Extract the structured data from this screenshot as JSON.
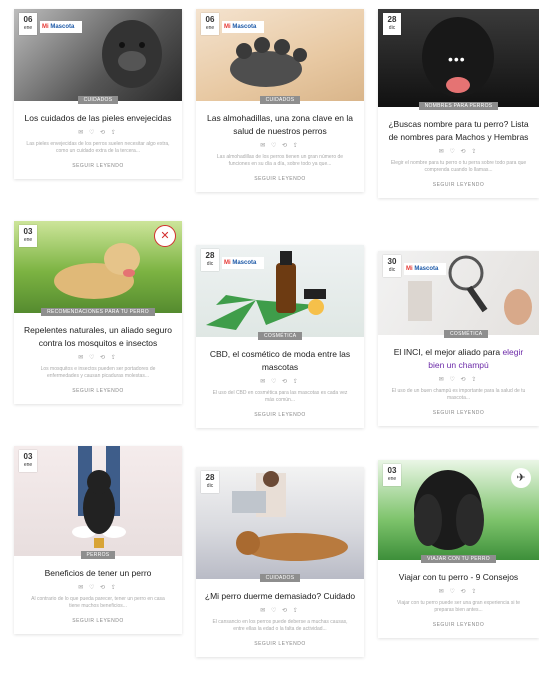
{
  "brand": {
    "part1": "Mi ",
    "part2": "Mascota"
  },
  "cards": [
    {
      "day": "06",
      "month": "ene",
      "category": "Cuidados",
      "title": "Los cuidados de las pieles envejecidas",
      "meta": "✉ ♡ ⟲ ⇪",
      "excerpt": "Las pieles envejecidas de los perros suelen necesitar algo extra, como un cuidado extra de la tercera...",
      "more": "Seguir leyendo"
    },
    {
      "day": "06",
      "month": "ene",
      "category": "Cuidados",
      "title": "Las almohadillas, una zona clave en la salud de nuestros perros",
      "meta": "✉ ♡ ⟲ ⇪",
      "excerpt": "Las almohadillas de los perros tienen un gran número de funciones en su día a día, sobre todo ya que...",
      "more": "Seguir leyendo"
    },
    {
      "day": "28",
      "month": "dic",
      "category": "Nombres para perros",
      "title": "¿Buscas nombre para tu perro? Lista de nombres para Machos y Hembras",
      "meta": "✉ ♡ ⟲ ⇪",
      "excerpt": "Elegir el nombre para tu perro o tu perra sobre todo para que comprenda cuando lo llamas...",
      "more": "Seguir leyendo"
    },
    {
      "day": "03",
      "month": "ene",
      "category": "Recomendaciones para tu perro",
      "title": "Repelentes naturales, un aliado seguro contra los mosquitos e insectos",
      "meta": "✉ ♡ ⟲ ⇪",
      "excerpt": "Los mosquitos e insectos pueden ser portadores de enfermedades y causan picaduras molestas...",
      "more": "Seguir leyendo"
    },
    {
      "day": "28",
      "month": "dic",
      "category": "Cosmética",
      "title": "CBD, el cosmético de moda entre las mascotas",
      "meta": "✉ ♡ ⟲ ⇪",
      "excerpt": "El uso del CBD en cosmética para las mascotas es cada vez más común...",
      "more": "Seguir leyendo"
    },
    {
      "day": "30",
      "month": "dic",
      "category": "Cosmética",
      "title_a": "El INCI, el mejor aliado para ",
      "title_b": "elegir bien un champú",
      "meta": "✉ ♡ ⟲ ⇪",
      "excerpt": "El uso de un buen champú es importante para la salud de tu mascota...",
      "more": "Seguir leyendo"
    },
    {
      "day": "03",
      "month": "ene",
      "category": "Perros",
      "title": "Beneficios de tener un perro",
      "meta": "✉ ♡ ⟲ ⇪",
      "excerpt": "Al contrario de lo que pueda parecer, tener un perro en casa tiene muchos beneficios...",
      "more": "Seguir leyendo"
    },
    {
      "day": "28",
      "month": "dic",
      "category": "Cuidados",
      "title": "¿Mi perro duerme demasiado? Cuidado",
      "meta": "✉ ♡ ⟲ ⇪",
      "excerpt": "El cansancio en los perros puede deberse a muchas causas, entre ellas la edad o la falta de actividad...",
      "more": "Seguir leyendo"
    },
    {
      "day": "03",
      "month": "ene",
      "category": "Viajar con tu perro",
      "title": "Viajar con tu perro - 9 Consejos",
      "meta": "✉ ♡ ⟲ ⇪",
      "excerpt": "Viajar con tu perro puede ser una gran experiencia si te preparas bien antes...",
      "more": "Seguir leyendo"
    }
  ],
  "icons": {
    "insect": "bug-off-icon",
    "plane": "airplane-icon",
    "dots": "ellipsis-icon"
  }
}
